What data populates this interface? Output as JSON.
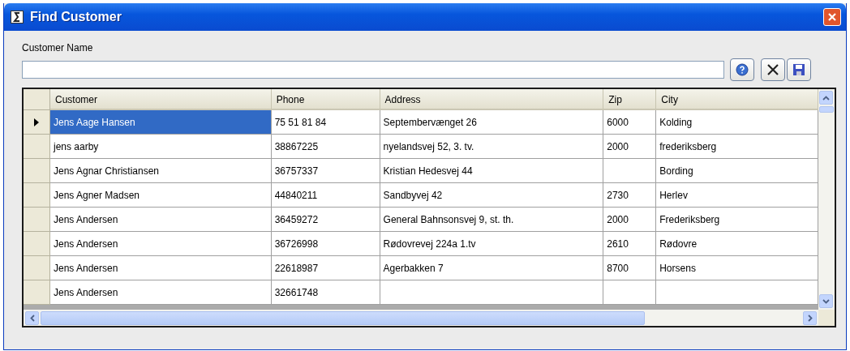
{
  "window": {
    "title": "Find Customer"
  },
  "search": {
    "label": "Customer Name"
  },
  "table": {
    "columns": [
      "Customer",
      "Phone",
      "Address",
      "Zip",
      "City"
    ],
    "rows": [
      {
        "selected": true,
        "cells": [
          "Jens Aage Hansen",
          "75 51 81 84",
          "Septembervænget 26",
          "6000",
          "Kolding"
        ]
      },
      {
        "selected": false,
        "cells": [
          "jens aarby",
          "38867225",
          "nyelandsvej 52, 3. tv.",
          "2000",
          "frederiksberg"
        ]
      },
      {
        "selected": false,
        "cells": [
          "Jens Agnar Christiansen",
          "36757337",
          "Kristian Hedesvej 44",
          "",
          "Bording"
        ]
      },
      {
        "selected": false,
        "cells": [
          "Jens Agner Madsen",
          "44840211",
          "Sandbyvej 42",
          "2730",
          "Herlev"
        ]
      },
      {
        "selected": false,
        "cells": [
          "Jens Andersen",
          "36459272",
          "General Bahnsonsvej 9, st. th.",
          "2000",
          "Frederiksberg"
        ]
      },
      {
        "selected": false,
        "cells": [
          "Jens Andersen",
          "36726998",
          "Rødovrevej 224a 1.tv",
          "2610",
          "Rødovre"
        ]
      },
      {
        "selected": false,
        "cells": [
          "Jens Andersen",
          "22618987",
          "Agerbakken 7",
          "8700",
          "Horsens"
        ]
      },
      {
        "selected": false,
        "cells": [
          "Jens Andersen",
          "32661748",
          "",
          "",
          ""
        ]
      }
    ]
  }
}
